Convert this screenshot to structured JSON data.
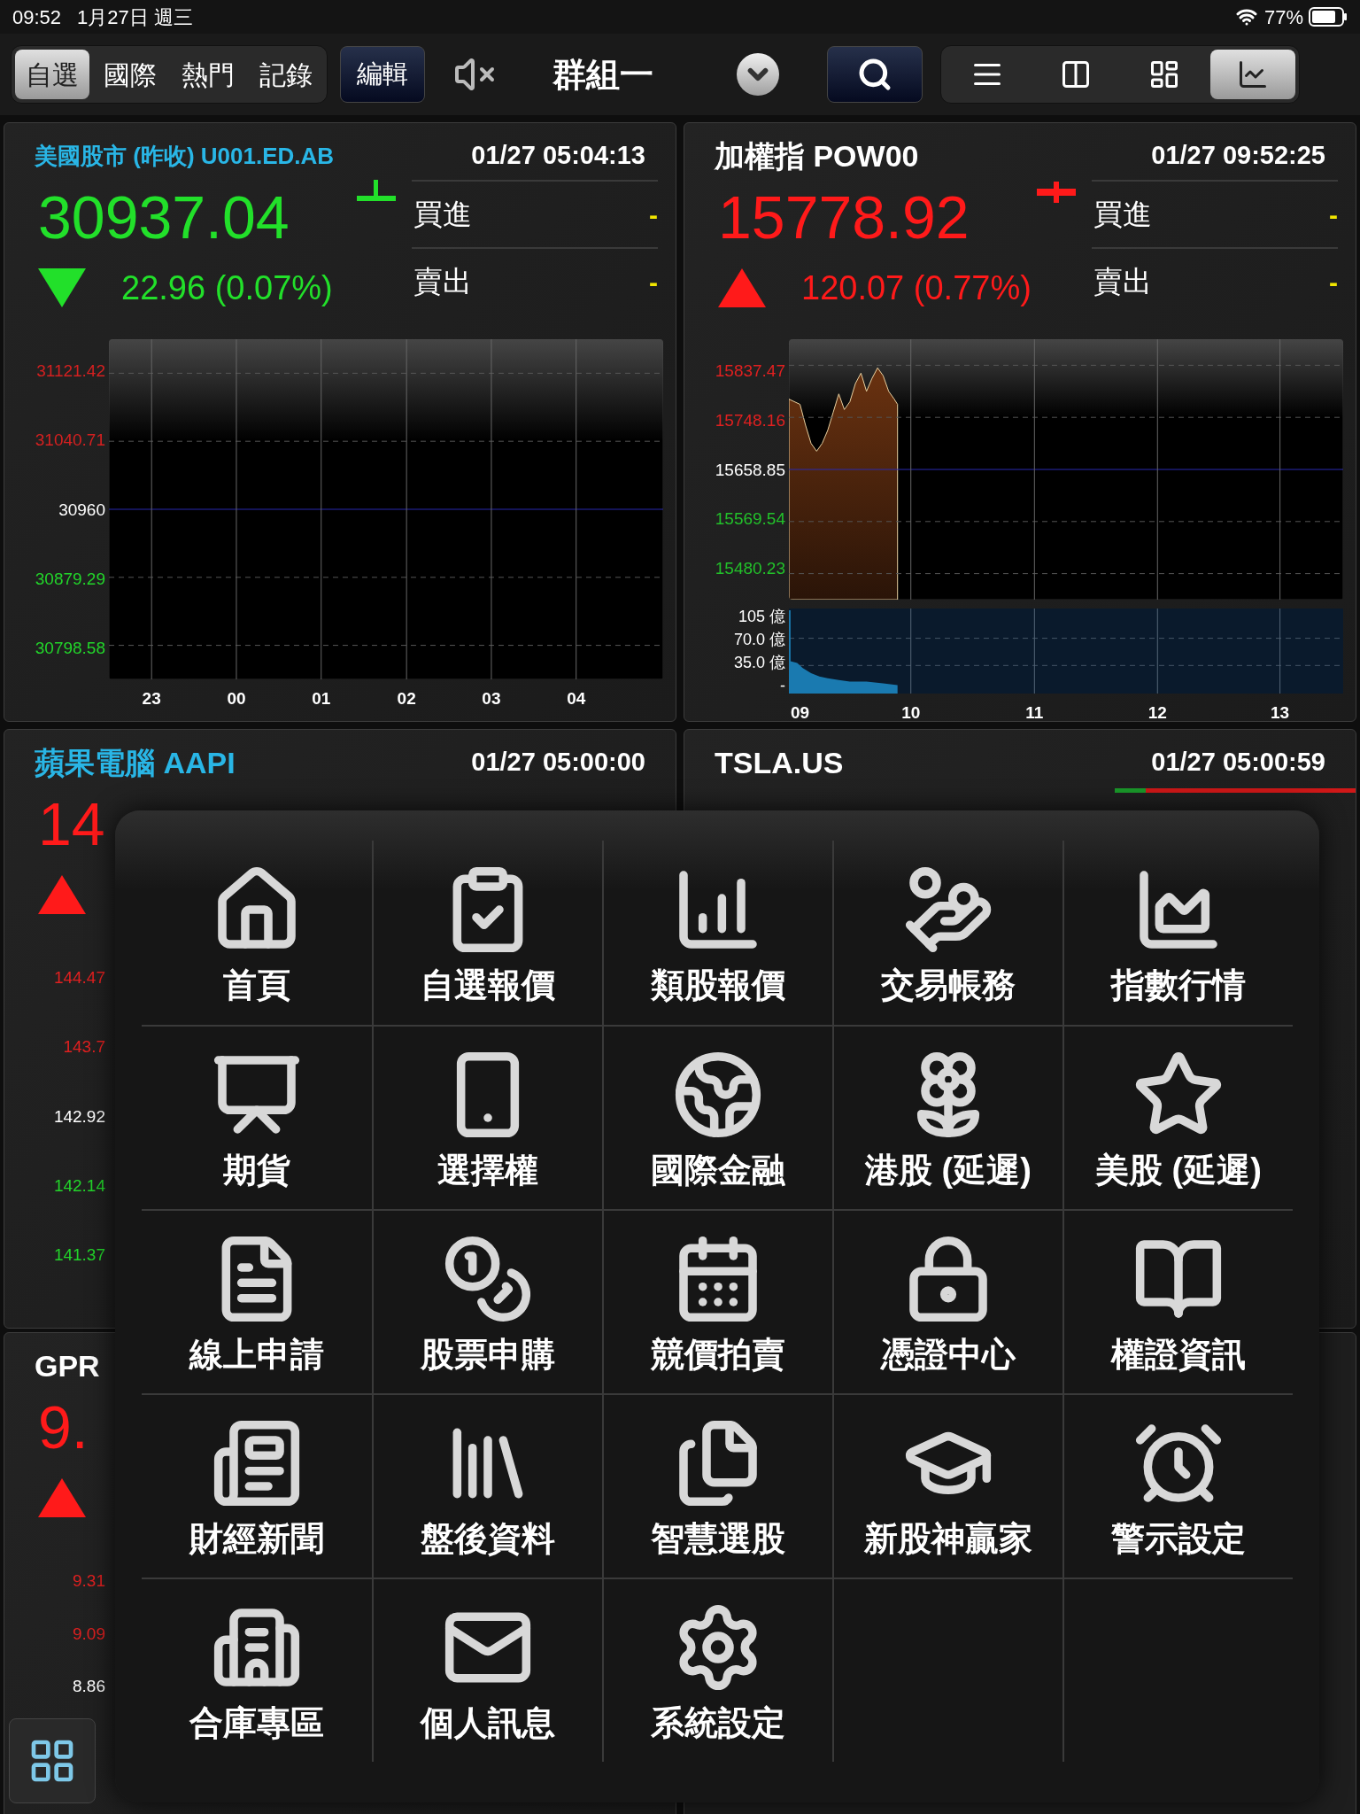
{
  "status_bar": {
    "time": "09:52",
    "date": "1月27日 週三",
    "battery": "77%"
  },
  "toolbar": {
    "tabs": [
      {
        "label": "自選",
        "selected": true
      },
      {
        "label": "國際",
        "selected": false
      },
      {
        "label": "熱門",
        "selected": false
      },
      {
        "label": "記錄",
        "selected": false
      }
    ],
    "edit_button": "編輯",
    "muted": true,
    "group_title": "群組一",
    "view_buttons": [
      {
        "selected": false
      },
      {
        "selected": false
      },
      {
        "selected": false
      },
      {
        "selected": true
      }
    ]
  },
  "cards": [
    {
      "title": "美國股市 (昨收) U001.ED.AB",
      "color": "#29b6e6",
      "time": "01/27 05:04:13",
      "price": "30937.04",
      "up": false,
      "change": "22.96",
      "change_pct": "(0.07%)",
      "quotes": [
        {
          "label": "買進",
          "value": "-"
        },
        {
          "label": "賣出",
          "value": "-"
        }
      ],
      "chart": {
        "y_labels": [
          {
            "text": "31121.42",
            "color": "#d42020"
          },
          {
            "text": "31040.71",
            "color": "#d42020"
          },
          {
            "text": "30960",
            "color": "#ffffff"
          },
          {
            "text": "30879.29",
            "color": "#22d42a"
          },
          {
            "text": "30798.58",
            "color": "#22d42a"
          }
        ],
        "x_labels": [
          "23",
          "00",
          "01",
          "02",
          "03",
          "04"
        ]
      }
    },
    {
      "title": "加權指 POW00",
      "color": "#ffffff",
      "time": "01/27 09:52:25",
      "price": "15778.92",
      "up": true,
      "change": "120.07",
      "change_pct": "(0.77%)",
      "quotes": [
        {
          "label": "買進",
          "value": "-"
        },
        {
          "label": "賣出",
          "value": "-"
        }
      ],
      "chart": {
        "y_labels": [
          {
            "text": "15837.47",
            "color": "#e02020"
          },
          {
            "text": "15748.16",
            "color": "#e02020"
          },
          {
            "text": "15658.85",
            "color": "#ffffff"
          },
          {
            "text": "15569.54",
            "color": "#22c02a"
          },
          {
            "text": "15480.23",
            "color": "#22c02a"
          }
        ],
        "volume_labels": [
          "105 億",
          "70.0 億",
          "35.0 億",
          "-"
        ],
        "x_labels": [
          "09",
          "10",
          "11",
          "12",
          "13"
        ]
      }
    },
    {
      "title": "蘋果電腦 AAPI",
      "color": "#29b6e6",
      "time": "01/27 05:00:00",
      "price": "14",
      "up": true,
      "chart": {
        "y_labels": [
          {
            "text": "144.47",
            "color": "#e02020"
          },
          {
            "text": "143.7",
            "color": "#e02020"
          },
          {
            "text": "142.92",
            "color": "#ffffff"
          },
          {
            "text": "142.14",
            "color": "#22d42a"
          },
          {
            "text": "141.37",
            "color": "#22d42a"
          }
        ]
      }
    },
    {
      "title": "TSLA.US",
      "color": "#ffffff",
      "time": "01/27 05:00:59",
      "bid_ask": {
        "level": 0.13
      }
    },
    {
      "title": "GPR",
      "color": "#ffffff",
      "price": "9.",
      "up": true,
      "chart": {
        "y_labels": [
          {
            "text": "9.31",
            "color": "#e02020"
          },
          {
            "text": "9.09",
            "color": "#e02020"
          },
          {
            "text": "8.86",
            "color": "#ffffff"
          }
        ]
      }
    }
  ],
  "menu": {
    "items": [
      {
        "label": "首頁"
      },
      {
        "label": "自選報價"
      },
      {
        "label": "類股報價"
      },
      {
        "label": "交易帳務"
      },
      {
        "label": "指數行情"
      },
      {
        "label": "期貨"
      },
      {
        "label": "選擇權"
      },
      {
        "label": "國際金融"
      },
      {
        "label": "港股 (延遲)"
      },
      {
        "label": "美股 (延遲)"
      },
      {
        "label": "線上申請"
      },
      {
        "label": "股票申購"
      },
      {
        "label": "競價拍賣"
      },
      {
        "label": "憑證中心"
      },
      {
        "label": "權證資訊"
      },
      {
        "label": "財經新聞"
      },
      {
        "label": "盤後資料"
      },
      {
        "label": "智慧選股"
      },
      {
        "label": "新股神贏家"
      },
      {
        "label": "警示設定"
      },
      {
        "label": "合庫專區"
      },
      {
        "label": "個人訊息"
      },
      {
        "label": "系統設定"
      }
    ]
  }
}
